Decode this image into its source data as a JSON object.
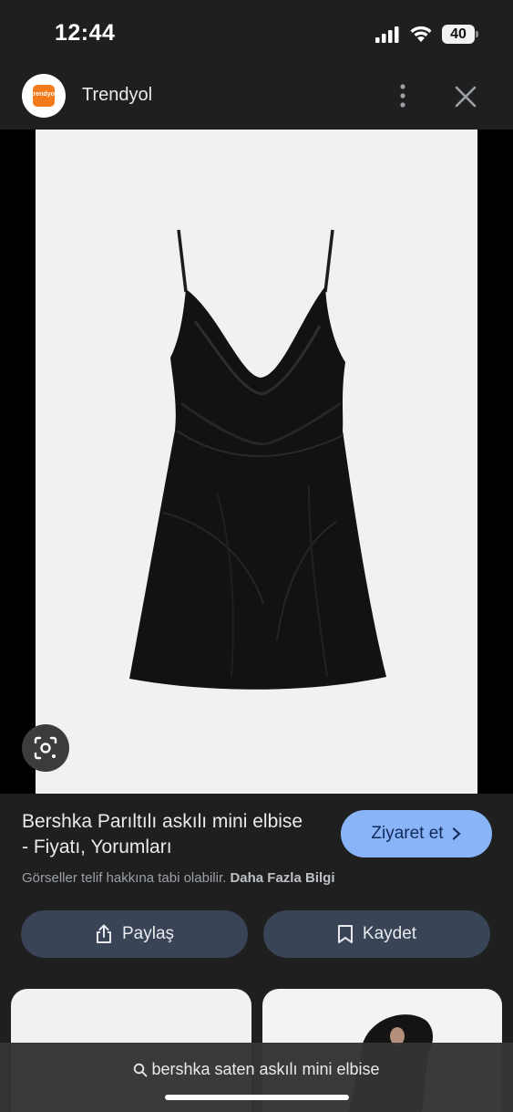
{
  "status_bar": {
    "time": "12:44",
    "battery": "40"
  },
  "header": {
    "site_name": "Trendyol",
    "logo_text": "trendyol",
    "brand_color": "#f27a1a"
  },
  "image": {
    "alt": "Bershka Parıltılı askılı mini elbise"
  },
  "info": {
    "title": "Bershka Parıltılı askılı mini elbise - Fiyatı, Yorumları",
    "visit_label": "Ziyaret et",
    "copyright_text": "Görseller telif hakkına tabi olabilir.",
    "more_info_label": "Daha Fazla Bilgi",
    "share_label": "Paylaş",
    "save_label": "Kaydet"
  },
  "search": {
    "query": "bershka saten askılı mini elbise"
  },
  "colors": {
    "background": "#1f1f1f",
    "accent_button": "#8ab4f8",
    "secondary_button": "#394457"
  }
}
